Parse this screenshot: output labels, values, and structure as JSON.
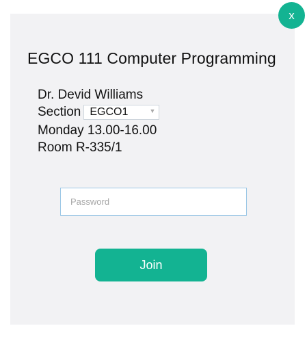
{
  "dialog": {
    "close_label": "x",
    "title": "EGCO 111 Computer Programming",
    "instructor": "Dr. Devid Williams",
    "section_label": "Section",
    "section_value": "EGCO1",
    "schedule": "Monday 13.00-16.00",
    "room": "Room R-335/1",
    "password_placeholder": "Password",
    "join_label": "Join"
  },
  "colors": {
    "accent": "#13b392",
    "panel_background": "#f2f2f4",
    "input_border": "#9cc7e6"
  },
  "icons": {
    "dropdown": "chevron-down-icon"
  }
}
